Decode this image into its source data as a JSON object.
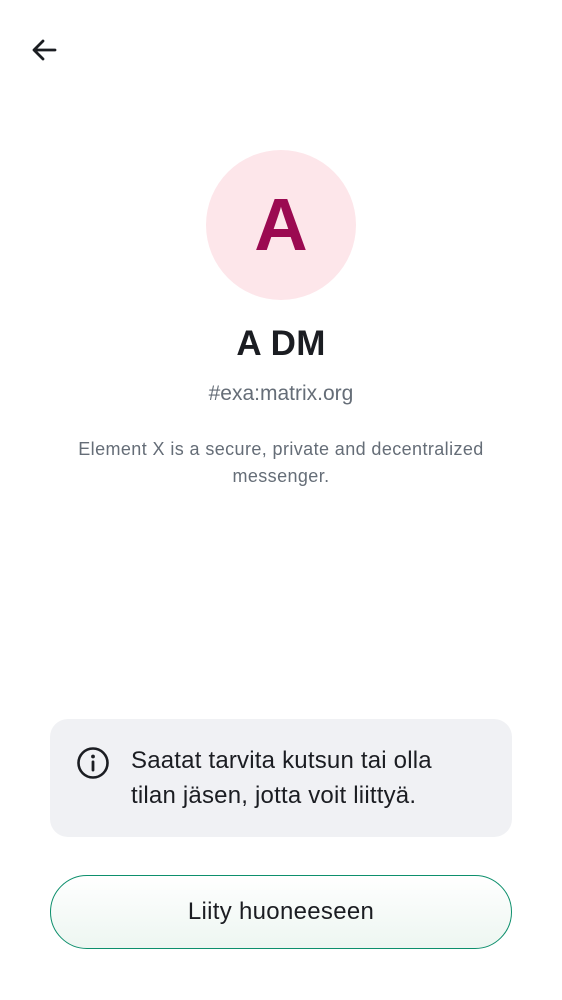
{
  "header": {
    "back_icon": "arrow-left-icon"
  },
  "room": {
    "avatar_letter": "A",
    "name": "A DM",
    "alias": "#exa:matrix.org",
    "description": "Element X is a secure, private and decentralized messenger."
  },
  "notice": {
    "icon": "info-icon",
    "text": "Saatat tarvita kutsun tai olla tilan jäsen, jotta voit liittyä."
  },
  "actions": {
    "join_label": "Liity huoneeseen"
  },
  "colors": {
    "avatar_background": "#fde6ea",
    "avatar_letter": "#9b0a51",
    "notice_background": "#f0f1f4",
    "join_border": "#0d8f6c"
  }
}
